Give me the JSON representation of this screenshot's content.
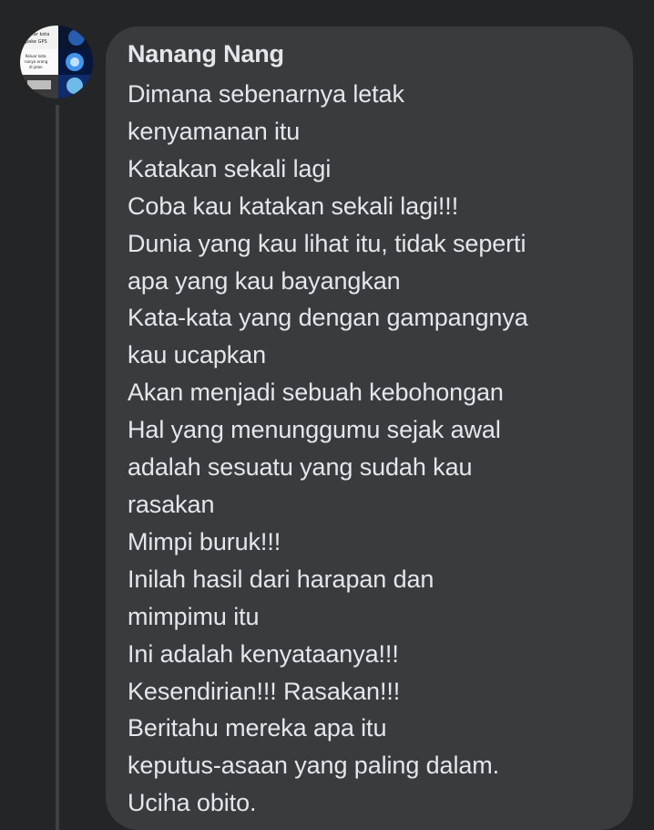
{
  "comment": {
    "author": "Nanang Nang",
    "lines": [
      "Dimana sebenarnya letak",
      "kenyamanan itu",
      "Katakan sekali lagi",
      "Coba kau katakan sekali lagi!!!",
      "Dunia yang kau lihat itu, tidak seperti",
      "apa yang kau bayangkan",
      "Kata-kata yang dengan gampangnya",
      "kau ucapkan",
      "Akan menjadi sebuah kebohongan",
      "Hal yang menunggumu sejak awal",
      "adalah sesuatu yang sudah kau",
      "rasakan",
      "Mimpi buruk!!!",
      "Inilah hasil dari harapan dan",
      "mimpimu itu",
      "Ini adalah kenyataanya!!!",
      "Kesendirian!!! Rasakan!!!",
      "Beritahu mereka apa itu",
      "keputus-asaan yang paling dalam.",
      "Uciha obito."
    ]
  },
  "avatar": {
    "text_top": [
      "...ar kota",
      "pake GPS"
    ],
    "text_bottom": [
      "Keluar kota",
      "nanya orang",
      "di jalan"
    ]
  },
  "colors": {
    "background": "#242526",
    "bubble": "#3a3b3c",
    "text": "#e4e6eb",
    "thread_line": "#3e4042"
  }
}
